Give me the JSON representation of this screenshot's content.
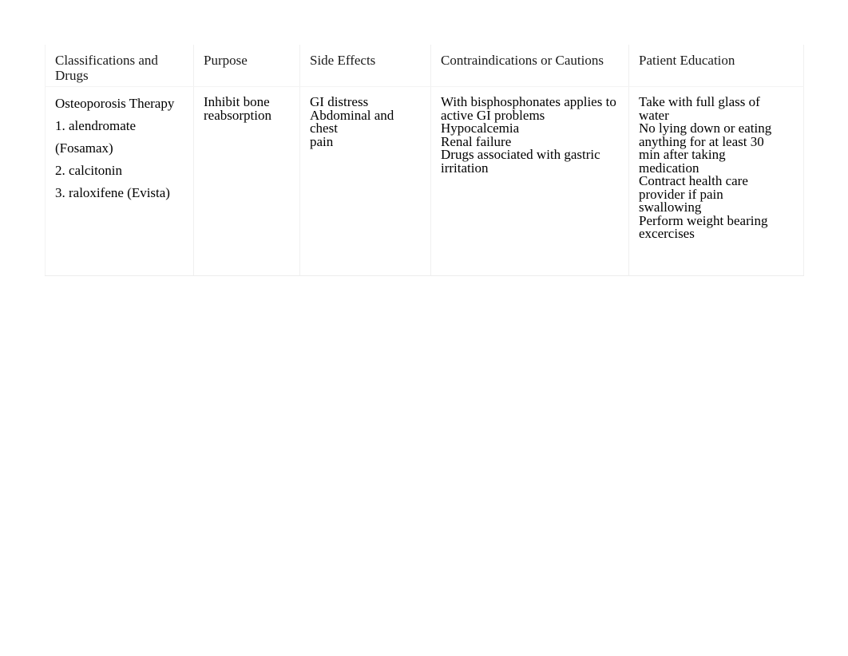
{
  "document": {
    "type": "drug-classification-table",
    "title": "Classifications and Drugs Reference Table"
  },
  "table": {
    "headers": [
      "Classifications and\nDrugs",
      "Purpose",
      "Side Effects",
      "Contraindications or Cautions",
      "Patient Education"
    ],
    "column_1": {
      "category": "Osteoporosis Therapy",
      "drugs": [
        "1. alendromate",
        "(Fosamax)",
        "2. calcitonin",
        "3. raloxifene (Evista)"
      ]
    },
    "column_2": {
      "lines": [
        "Inhibit bone",
        "reabsorption"
      ]
    },
    "column_3": {
      "lines": [
        "GI distress",
        "Abdominal and chest",
        "pain"
      ]
    },
    "column_4": {
      "lines": [
        "With bisphosphonates applies to",
        "active GI problems",
        "Hypocalcemia",
        "Renal failure",
        "Drugs associated with gastric",
        "irritation"
      ]
    },
    "column_5": {
      "lines": [
        "Take with full glass of",
        "water",
        "No lying down or eating",
        "anything for at least 30",
        "min after taking",
        "medication",
        "Contract health care",
        "provider if pain",
        "swallowing",
        "Perform weight bearing",
        "excercises"
      ]
    }
  },
  "colors": {
    "page_background": "#ffffff",
    "text": "#000000",
    "border": "#f0f0f0"
  }
}
